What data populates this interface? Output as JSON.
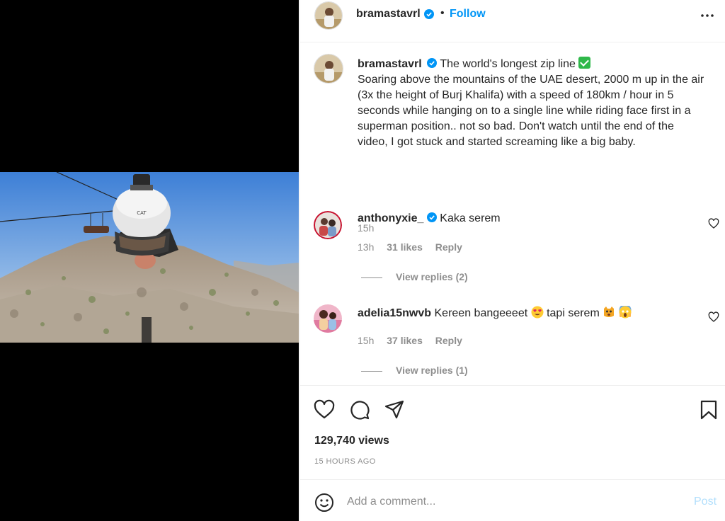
{
  "header": {
    "username": "bramastavrl",
    "separator": "•",
    "follow_label": "Follow"
  },
  "caption": {
    "username": "bramastavrl",
    "title": "The world's longest zip line",
    "body": "Soaring above the mountains of the UAE desert, 2000 m up in the air (3x the height of Burj Khalifa) with a speed of 180km / hour in 5 seconds while hanging on to a single line while riding face first in a superman position.. not so bad. Don't watch until the end of the video, I got stuck and started screaming like a big baby.",
    "time": "15h"
  },
  "comments": [
    {
      "username": "anthonyxie_",
      "verified": true,
      "text": "Kaka serem",
      "time": "13h",
      "likes": "31 likes",
      "reply_label": "Reply",
      "view_replies": "View replies (2)"
    },
    {
      "username": "adelia15nwvb",
      "verified": false,
      "text_part1": "Kereen bangeeeet",
      "text_part2": "tapi serem",
      "time": "15h",
      "likes": "37 likes",
      "reply_label": "Reply",
      "view_replies": "View replies (1)"
    }
  ],
  "stats": {
    "views": "129,740 views",
    "posted": "15 HOURS AGO"
  },
  "add_comment": {
    "placeholder": "Add a comment...",
    "post_label": "Post"
  },
  "icons": {
    "verified": "verified-badge-icon",
    "more": "more-options-icon",
    "like": "heart-icon",
    "comment": "comment-icon",
    "share": "share-icon",
    "save": "bookmark-icon",
    "emoji": "smile-icon"
  },
  "colors": {
    "accent": "#0095f6",
    "text": "#262626",
    "secondary": "#8e8e8e",
    "post_disabled": "#b2dffc"
  }
}
